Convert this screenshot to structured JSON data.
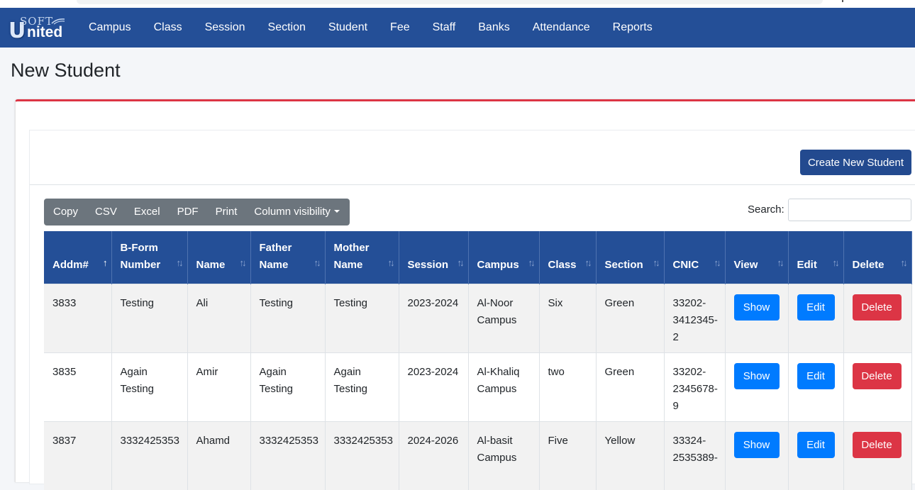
{
  "app": {
    "logo_text": "Soft United"
  },
  "nav": {
    "items": [
      "Campus",
      "Class",
      "Session",
      "Section",
      "Student",
      "Fee",
      "Staff",
      "Banks",
      "Attendance",
      "Reports"
    ]
  },
  "page": {
    "title": "New Student"
  },
  "actions": {
    "create_label": "Create New Student"
  },
  "table_tools": {
    "buttons": [
      "Copy",
      "CSV",
      "Excel",
      "PDF",
      "Print"
    ],
    "column_visibility_label": "Column visibility",
    "search_label": "Search:",
    "search_value": ""
  },
  "table": {
    "headers": [
      "Addm#",
      "B-Form Number",
      "Name",
      "Father Name",
      "Mother Name",
      "Session",
      "Campus",
      "Class",
      "Section",
      "CNIC",
      "View",
      "Edit",
      "Delete"
    ],
    "rows": [
      {
        "addm": "3833",
        "bform": "Testing",
        "name": "Ali",
        "father": "Testing",
        "mother": "Testing",
        "session": "2023-2024",
        "campus": "Al-Noor Campus",
        "class": "Six",
        "section": "Green",
        "cnic": "33202-3412345-2"
      },
      {
        "addm": "3835",
        "bform": "Again Testing",
        "name": "Amir",
        "father": "Again Testing",
        "mother": "Again Testing",
        "session": "2023-2024",
        "campus": "Al-Khaliq Campus",
        "class": "two",
        "section": "Green",
        "cnic": "33202-2345678-9"
      },
      {
        "addm": "3837",
        "bform": "3332425353",
        "name": "Ahamd",
        "father": "3332425353",
        "mother": "3332425353",
        "session": "2024-2026",
        "campus": "Al-basit Campus",
        "class": "Five",
        "section": "Yellow",
        "cnic": "33324-2535389-"
      }
    ],
    "row_buttons": {
      "show": "Show",
      "edit": "Edit",
      "delete": "Delete"
    },
    "sort_active_column": "Addm#"
  },
  "colors": {
    "navbar": "#244f97",
    "accent_red": "#dc3545",
    "primary_blue": "#007bff",
    "toolbar_gray": "#6c757d"
  }
}
